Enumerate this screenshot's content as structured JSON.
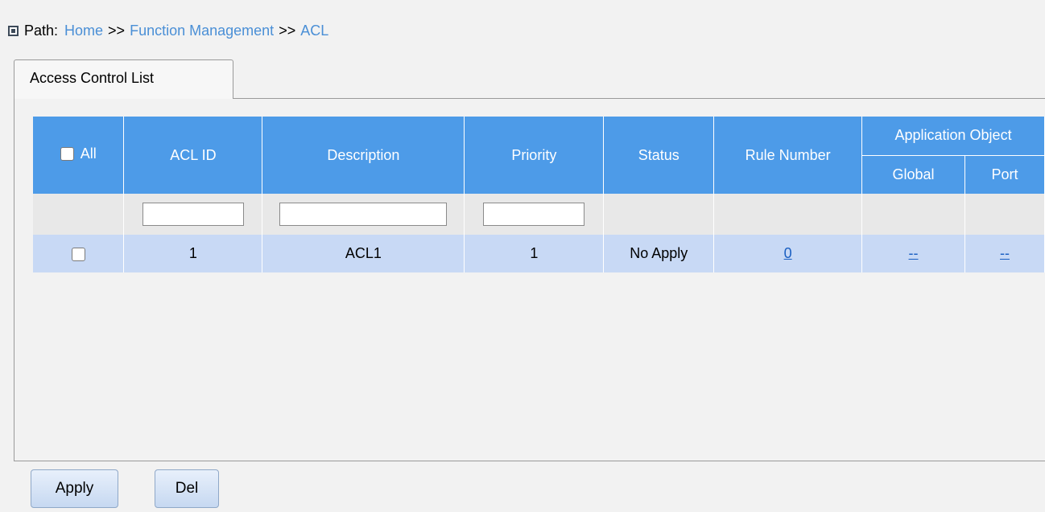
{
  "breadcrumb": {
    "label": "Path:",
    "items": [
      "Home",
      "Function Management",
      "ACL"
    ],
    "separator": ">>"
  },
  "tab": {
    "label": "Access Control List"
  },
  "table": {
    "headers": {
      "all": "All",
      "acl_id": "ACL ID",
      "description": "Description",
      "priority": "Priority",
      "status": "Status",
      "rule_number": "Rule Number",
      "application_object": "Application Object",
      "global": "Global",
      "port": "Port"
    },
    "filters": {
      "acl_id": "",
      "description": "",
      "priority": ""
    },
    "rows": [
      {
        "acl_id": "1",
        "description": "ACL1",
        "priority": "1",
        "status": "No Apply",
        "rule_number": "0",
        "global": "--",
        "port": "--"
      }
    ]
  },
  "buttons": {
    "apply": "Apply",
    "del": "Del"
  }
}
